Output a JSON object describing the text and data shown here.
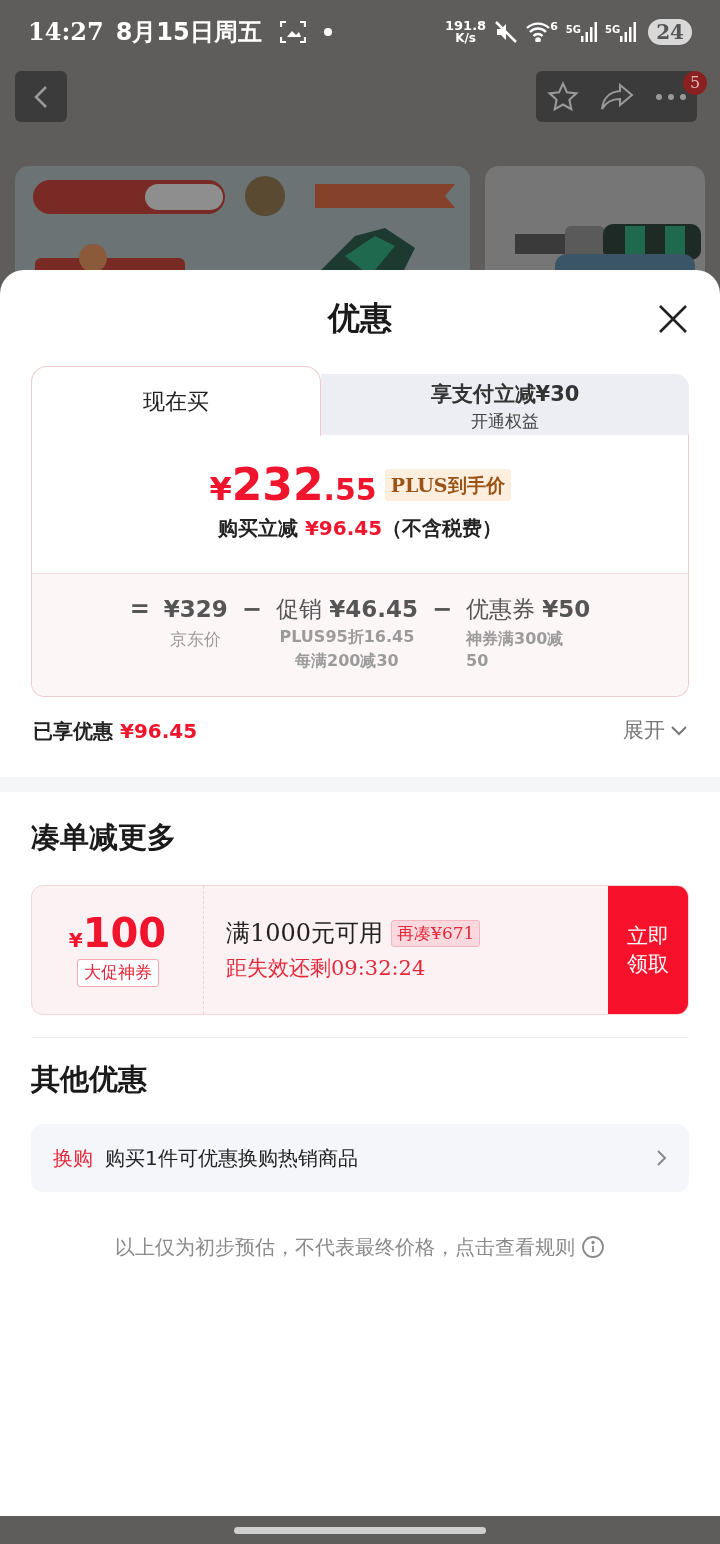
{
  "status_bar": {
    "time": "14:27",
    "date": "8月15日周五",
    "speed": "191.8",
    "speed_unit": "K/s",
    "wifi_sub": "6",
    "sim1": "5G",
    "sim2": "5G",
    "battery": "24"
  },
  "top_bar": {
    "badge": "5"
  },
  "sheet": {
    "title": "优惠",
    "tabs": [
      {
        "label": "现在买",
        "selected": true
      },
      {
        "label": "享支付立减¥30",
        "sub": "开通权益",
        "selected": false
      }
    ],
    "price": {
      "currency": "¥",
      "integer": "232",
      "decimal": ".55",
      "tag": "PLUS到手价"
    },
    "saving_line": {
      "prefix": "购买立减",
      "amount": "¥96.45",
      "suffix": "（不含税费）"
    },
    "breakdown": [
      {
        "op": "=",
        "value": "¥329",
        "notes": [
          "京东价"
        ]
      },
      {
        "op": "−",
        "label": "促销",
        "value": "¥46.45",
        "notes": [
          "PLUS95折16.45",
          "每满200减30"
        ]
      },
      {
        "op": "−",
        "label": "优惠券",
        "value": "¥50",
        "notes": [
          "神券满300减50"
        ]
      }
    ],
    "enjoyed": {
      "label": "已享优惠",
      "amount": "¥96.45",
      "expand": "展开"
    },
    "bundle": {
      "title": "凑单减更多",
      "coupon": {
        "currency": "¥",
        "amount": "100",
        "type": "大促神券",
        "condition": "满1000元可用",
        "gap": "再凑¥671",
        "countdown": "距失效还剩09:32:24",
        "button": "立即领取"
      }
    },
    "other": {
      "title": "其他优惠",
      "items": [
        {
          "tag": "换购",
          "text": "购买1件可优惠换购热销商品"
        }
      ]
    },
    "note": "以上仅为初步预估，不代表最终价格，点击查看规则"
  }
}
